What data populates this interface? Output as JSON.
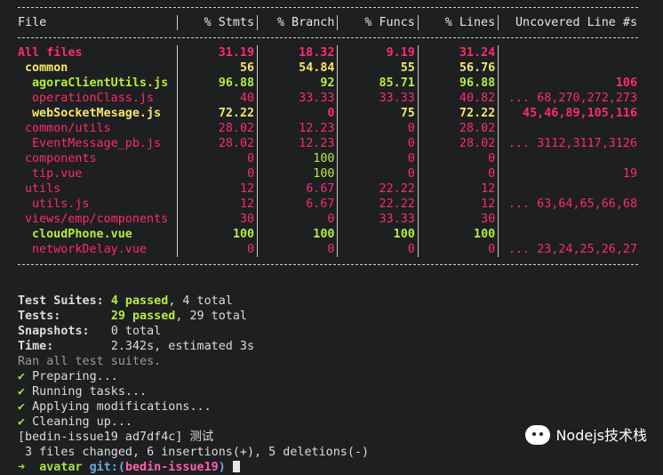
{
  "table": {
    "headers": [
      "File",
      "% Stmts",
      "% Branch",
      "% Funcs",
      "% Lines",
      "Uncovered Line #s"
    ],
    "rows": [
      {
        "file": "All files",
        "stmts": "31.19",
        "branch": "18.32",
        "funcs": "9.19",
        "lines": "31.24",
        "uncovered": "",
        "indent": 0,
        "colors": [
          "red",
          "red",
          "red",
          "red",
          "red",
          "red"
        ],
        "bold": true
      },
      {
        "file": "common",
        "stmts": "56",
        "branch": "54.84",
        "funcs": "55",
        "lines": "56.76",
        "uncovered": "",
        "indent": 1,
        "colors": [
          "yel",
          "yel",
          "yel",
          "yel",
          "yel",
          "yel"
        ],
        "bold": true
      },
      {
        "file": "agoraClientUtils.js",
        "stmts": "96.88",
        "branch": "92",
        "funcs": "85.71",
        "lines": "96.88",
        "uncovered": "106",
        "indent": 2,
        "colors": [
          "grn",
          "grn",
          "grn",
          "grn",
          "grn",
          "red"
        ],
        "bold": true
      },
      {
        "file": "operationClass.js",
        "stmts": "40",
        "branch": "33.33",
        "funcs": "33.33",
        "lines": "40.82",
        "uncovered": "... 68,270,272,273",
        "indent": 2,
        "colors": [
          "red",
          "red",
          "red",
          "red",
          "red",
          "red"
        ],
        "bold": false
      },
      {
        "file": "webSocketMesage.js",
        "stmts": "72.22",
        "branch": "0",
        "funcs": "75",
        "lines": "72.22",
        "uncovered": "45,46,89,105,116",
        "indent": 2,
        "colors": [
          "yel",
          "yel",
          "red",
          "yel",
          "yel",
          "red"
        ],
        "bold": true
      },
      {
        "file": "common/utils",
        "stmts": "28.02",
        "branch": "12.23",
        "funcs": "0",
        "lines": "28.02",
        "uncovered": "",
        "indent": 1,
        "colors": [
          "red",
          "red",
          "red",
          "red",
          "red",
          "red"
        ],
        "bold": false
      },
      {
        "file": "EventMessage_pb.js",
        "stmts": "28.02",
        "branch": "12.23",
        "funcs": "0",
        "lines": "28.02",
        "uncovered": "... 3112,3117,3126",
        "indent": 2,
        "colors": [
          "red",
          "red",
          "red",
          "red",
          "red",
          "red"
        ],
        "bold": false
      },
      {
        "file": "components",
        "stmts": "0",
        "branch": "100",
        "funcs": "0",
        "lines": "0",
        "uncovered": "",
        "indent": 1,
        "colors": [
          "red",
          "red",
          "grn",
          "red",
          "red",
          "red"
        ],
        "bold": false
      },
      {
        "file": "tip.vue",
        "stmts": "0",
        "branch": "100",
        "funcs": "0",
        "lines": "0",
        "uncovered": "19",
        "indent": 2,
        "colors": [
          "red",
          "red",
          "grn",
          "red",
          "red",
          "red"
        ],
        "bold": false
      },
      {
        "file": "utils",
        "stmts": "12",
        "branch": "6.67",
        "funcs": "22.22",
        "lines": "12",
        "uncovered": "",
        "indent": 1,
        "colors": [
          "red",
          "red",
          "red",
          "red",
          "red",
          "red"
        ],
        "bold": false
      },
      {
        "file": "utils.js",
        "stmts": "12",
        "branch": "6.67",
        "funcs": "22.22",
        "lines": "12",
        "uncovered": "... 63,64,65,66,68",
        "indent": 2,
        "colors": [
          "red",
          "red",
          "red",
          "red",
          "red",
          "red"
        ],
        "bold": false
      },
      {
        "file": "views/emp/components",
        "stmts": "30",
        "branch": "0",
        "funcs": "33.33",
        "lines": "30",
        "uncovered": "",
        "indent": 1,
        "colors": [
          "red",
          "red",
          "red",
          "red",
          "red",
          "red"
        ],
        "bold": false
      },
      {
        "file": "cloudPhone.vue",
        "stmts": "100",
        "branch": "100",
        "funcs": "100",
        "lines": "100",
        "uncovered": "",
        "indent": 2,
        "colors": [
          "grn",
          "grn",
          "grn",
          "grn",
          "grn",
          "grn"
        ],
        "bold": true
      },
      {
        "file": "networkDelay.vue",
        "stmts": "0",
        "branch": "0",
        "funcs": "0",
        "lines": "0",
        "uncovered": "... 23,24,25,26,27",
        "indent": 2,
        "colors": [
          "red",
          "red",
          "red",
          "red",
          "red",
          "red"
        ],
        "bold": false
      }
    ]
  },
  "summary": {
    "suites_label": "Test Suites:",
    "suites_passed": "4 passed",
    "suites_total": ", 4 total",
    "tests_label": "Tests:",
    "tests_passed": "29 passed",
    "tests_total": ", 29 total",
    "snapshots_label": "Snapshots:",
    "snapshots_value": "0 total",
    "time_label": "Time:",
    "time_value": "2.342s, estimated 3s",
    "ran_all": "Ran all test suites."
  },
  "tasks": [
    "Preparing...",
    "Running tasks...",
    "Applying modifications...",
    "Cleaning up..."
  ],
  "git": {
    "commit_line": "[bedin-issue19 ad7df4c] 测试",
    "stats_line": " 3 files changed, 6 insertions(+), 5 deletions(-)",
    "prompt_arrow": "➜",
    "prompt_dir": "avatar",
    "prompt_git": "git:(",
    "prompt_branch": "bedin-issue19",
    "prompt_close": ")"
  },
  "watermark": {
    "text": "Nodejs技术栈",
    "icon": "wechat-icon"
  },
  "colors": {
    "background": "#1d1f21",
    "red": "#ff2a6d",
    "yellow": "#f8e66a",
    "green": "#b7ee3a",
    "check": "#a6e23a"
  }
}
